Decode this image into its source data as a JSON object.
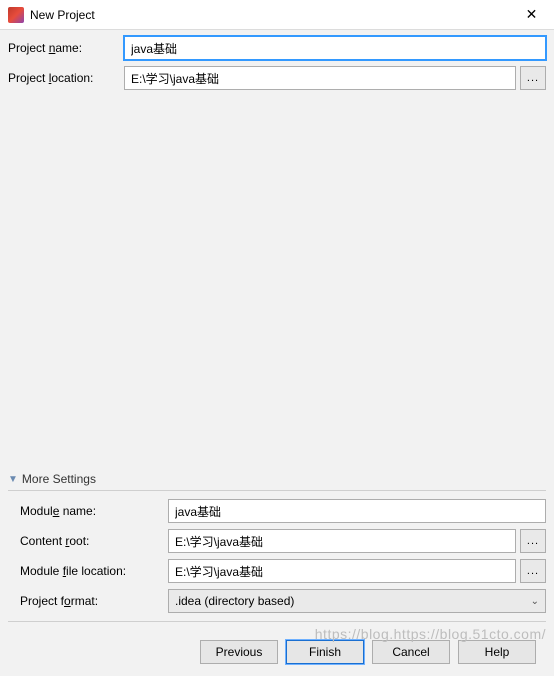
{
  "window": {
    "title": "New Project",
    "close_glyph": "✕"
  },
  "fields": {
    "project_name": {
      "label_pre": "Project ",
      "label_mn": "n",
      "label_post": "ame:",
      "value": "java基础"
    },
    "project_location": {
      "label_pre": "Project ",
      "label_mn": "l",
      "label_post": "ocation:",
      "value": "E:\\学习\\java基础"
    }
  },
  "more_settings": {
    "header": "More Settings",
    "module_name": {
      "label_pre": "Modul",
      "label_mn": "e",
      "label_post": " name:",
      "value": "java基础"
    },
    "content_root": {
      "label_pre": "Content ",
      "label_mn": "r",
      "label_post": "oot:",
      "value": "E:\\学习\\java基础"
    },
    "module_file_location": {
      "label_pre": "Module ",
      "label_mn": "f",
      "label_post": "ile location:",
      "value": "E:\\学习\\java基础"
    },
    "project_format": {
      "label_pre": "Project f",
      "label_mn": "o",
      "label_post": "rmat:",
      "value": ".idea (directory based)"
    }
  },
  "buttons": {
    "previous": "Previous",
    "finish": "Finish",
    "cancel": "Cancel",
    "help": "Help"
  },
  "browse_dots": "...",
  "watermark": "https://blog.https://blog.51cto.com/"
}
